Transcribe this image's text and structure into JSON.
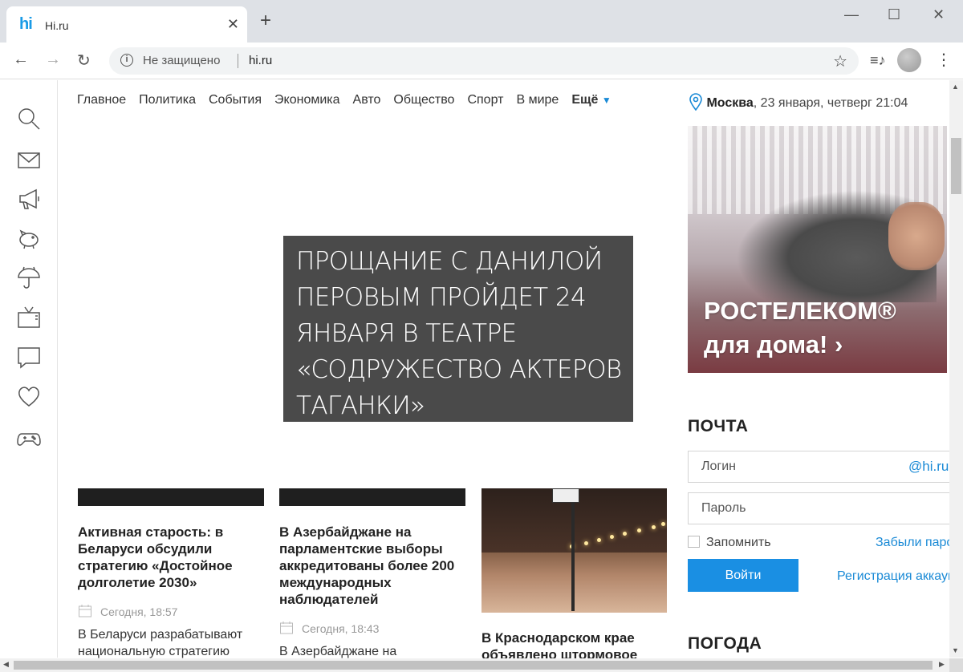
{
  "browser": {
    "tab_title": "Hi.ru",
    "tab_favicon": "hi",
    "tab_close": "✕",
    "new_tab": "+",
    "address_warning": "Не защищено",
    "url": "hi.ru"
  },
  "nav": {
    "items": [
      "Главное",
      "Политика",
      "События",
      "Экономика",
      "Авто",
      "Общество",
      "Спорт",
      "В мире"
    ],
    "more_label": "Ещё",
    "more_caret": "▼"
  },
  "location": {
    "city": "Москва",
    "datetime": ", 23 января, четверг 21:04"
  },
  "hero": {
    "headline": "ПРОЩАНИЕ С ДАНИЛОЙ ПЕРОВЫМ ПРОЙДЕТ 24 ЯНВАРЯ В ТЕАТРЕ «СОДРУЖЕСТВО АКТЕРОВ ТАГАНКИ»"
  },
  "ad": {
    "line1": "РОСТЕЛЕКОМ®",
    "line2": "для дома! ›"
  },
  "mail": {
    "title": "ПОЧТА",
    "login_placeholder": "Логин",
    "domain": "@hi.ru",
    "password_placeholder": "Пароль",
    "remember_label": "Запомнить",
    "forgot_label": "Забыли пароль?",
    "login_button": "Войти",
    "register_label": "Регистрация аккаунта"
  },
  "weather": {
    "title": "ПОГОДА"
  },
  "news": [
    {
      "title": "Активная старость: в Беларуси обсудили стратегию «Достойное долголетие 2030»",
      "time": "Сегодня, 18:57",
      "lead": "В Беларуси разрабатывают национальную стратегию"
    },
    {
      "title": "В Азербайджане на парламентские выборы аккредитованы более 200 международных наблюдателей",
      "time": "Сегодня, 18:43",
      "lead": "В Азербайджане на"
    },
    {
      "title": "В Краснодарском крае объявлено штормовое"
    }
  ],
  "colors": {
    "accent": "#1a8fe3",
    "hero_bg": "#4a4a4a"
  }
}
